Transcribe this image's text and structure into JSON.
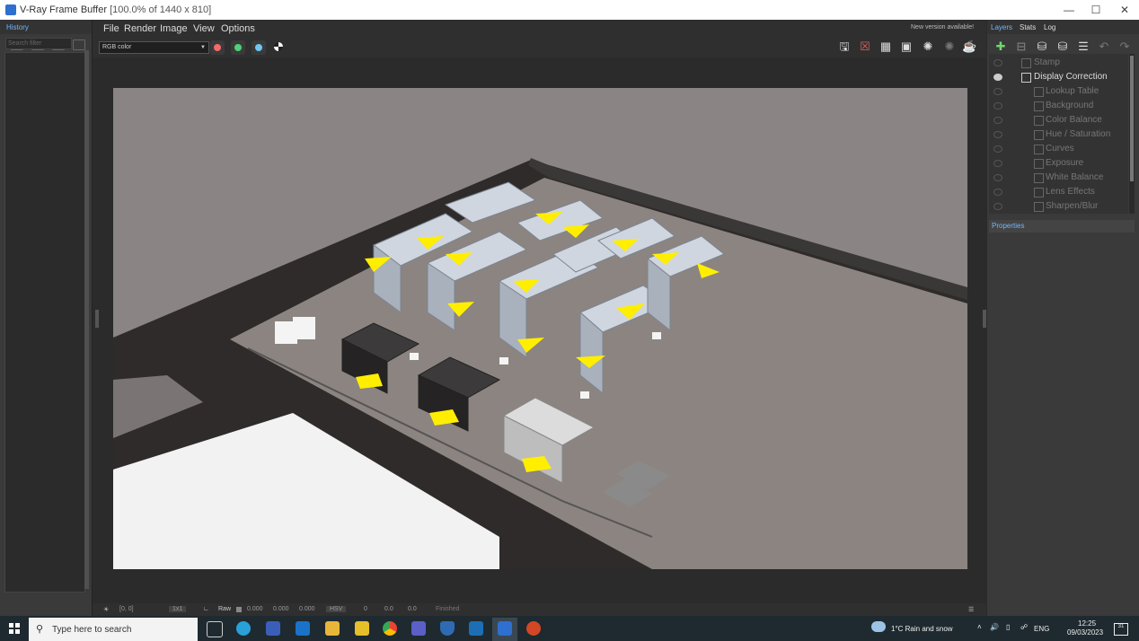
{
  "window": {
    "title_app": "V-Ray Frame Buffer",
    "title_info": "[100.0% of 1440 x 810]"
  },
  "menu": [
    "File",
    "Render",
    "Image",
    "View",
    "Options"
  ],
  "notice": "New version available!",
  "channel_select": "RGB color",
  "history": {
    "tab": "History",
    "search_placeholder": "Search filter"
  },
  "right_tabs": [
    "Layers",
    "Stats",
    "Log"
  ],
  "layers": [
    {
      "label": "Stamp",
      "level": 0
    },
    {
      "label": "Display Correction",
      "level": 0,
      "visible": true
    },
    {
      "label": "Lookup Table",
      "level": 1
    },
    {
      "label": "Background",
      "level": 1
    },
    {
      "label": "Color Balance",
      "level": 1
    },
    {
      "label": "Hue / Saturation",
      "level": 1
    },
    {
      "label": "Curves",
      "level": 1
    },
    {
      "label": "Exposure",
      "level": 1
    },
    {
      "label": "White Balance",
      "level": 1
    },
    {
      "label": "Lens Effects",
      "level": 1
    },
    {
      "label": "Sharpen/Blur",
      "level": 1
    }
  ],
  "properties_label": "Properties",
  "status": {
    "coords": "[0, 0]",
    "zoom": "1x1",
    "raw_label": "Raw",
    "raw_values": [
      "0.000",
      "0.000",
      "0.000"
    ],
    "mode": "HSV",
    "hsv_values": [
      "0",
      "0.0",
      "0.0"
    ],
    "state": "Finished"
  },
  "taskbar": {
    "search_placeholder": "Type here to search",
    "weather": "1°C  Rain and snow",
    "lang": "ENG",
    "time": "12:25",
    "date": "09/03/2023",
    "notif": "31"
  },
  "colors": {
    "accent": "#6fb6ff",
    "red_dot": "#f06b6b",
    "green_dot": "#4fd07a",
    "blue_dot": "#6ec6f5",
    "highlight_yellow": "#ffee00"
  }
}
